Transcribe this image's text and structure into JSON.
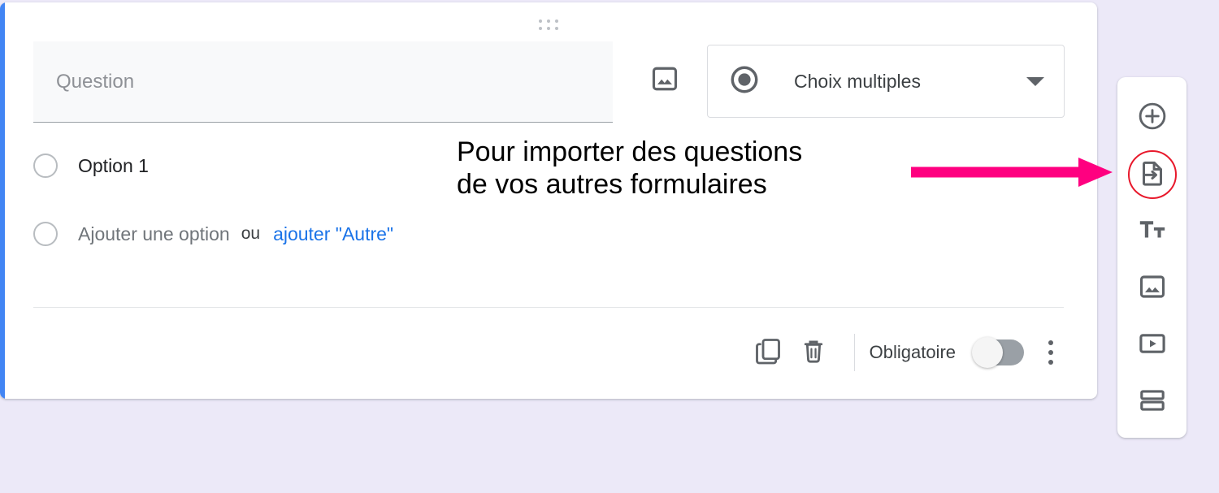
{
  "app": {
    "background_color": "#ece9f8",
    "card_accent_color": "#4285f4",
    "link_color": "#1a73e8",
    "annotation_arrow_color": "#ff0080",
    "highlight_ring_color": "#e8192c"
  },
  "question_card": {
    "drag_handle_name": "drag-handle",
    "question_field": {
      "value": "",
      "placeholder": "Question"
    },
    "image_button_label": "image-icon",
    "type_select": {
      "selected": "Choix multiples",
      "icon": "radio-button-icon",
      "caret": "chevron-down-icon"
    },
    "options": [
      {
        "label": "Option 1",
        "style": "filled"
      }
    ],
    "add_option": {
      "label": "Ajouter une option",
      "separator": "ou",
      "other_link": "ajouter \"Autre\""
    },
    "toolbar": {
      "duplicate_label": "duplicate-icon",
      "delete_label": "delete-icon",
      "required_label": "Obligatoire",
      "required_on": false,
      "more_label": "more-options-icon"
    }
  },
  "side_toolbar": {
    "items": [
      {
        "name": "add-question",
        "icon": "add-circle-icon",
        "highlighted": false
      },
      {
        "name": "import-questions",
        "icon": "import-file-icon",
        "highlighted": true
      },
      {
        "name": "add-title-description",
        "icon": "text-tt-icon",
        "highlighted": false
      },
      {
        "name": "add-image",
        "icon": "image-icon",
        "highlighted": false
      },
      {
        "name": "add-video",
        "icon": "video-icon",
        "highlighted": false
      },
      {
        "name": "add-section",
        "icon": "section-icon",
        "highlighted": false
      }
    ]
  },
  "annotation": {
    "text": "Pour importer des questions\nde vos autres formulaires",
    "arrow": "right-arrow"
  }
}
